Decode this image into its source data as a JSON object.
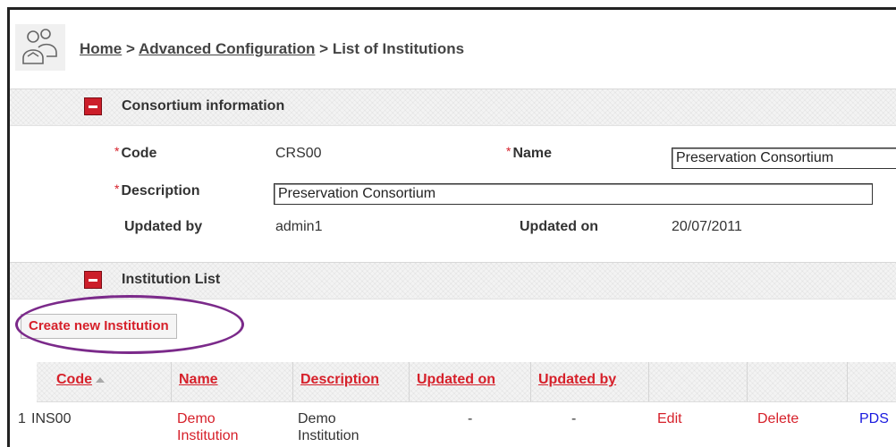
{
  "breadcrumb": {
    "home": "Home",
    "sep1": ">",
    "advanced": "Advanced Configuration",
    "sep2": ">",
    "current": "List of Institutions"
  },
  "icons": {
    "logo": "users-icon",
    "section_toggle": "collapse-icon",
    "sort": "sort-ascending-icon"
  },
  "consortium": {
    "section_title": "Consortium information",
    "required_marker": "*",
    "code_label": "Code",
    "code_value": "CRS00",
    "name_label": "Name",
    "name_value": "Preservation Consortium",
    "description_label": "Description",
    "description_value": "Preservation Consortium",
    "updated_by_label": "Updated by",
    "updated_by_value": "admin1",
    "updated_on_label": "Updated on",
    "updated_on_value": "20/07/2011"
  },
  "institutions": {
    "section_title": "Institution List",
    "create_button": "Create new Institution",
    "columns": [
      "Code",
      "Name",
      "Description",
      "Updated on",
      "Updated by"
    ],
    "rows": [
      {
        "index": "1",
        "code": "INS00",
        "name": "Demo Institution",
        "description": "Demo Institution",
        "updated_on": "-",
        "updated_by": "-",
        "edit": "Edit",
        "delete": "Delete",
        "pds": "PDS"
      }
    ]
  },
  "colors": {
    "link_red": "#d6202a",
    "link_blue": "#1a1adf",
    "highlight_ellipse": "#7b2a8a"
  }
}
